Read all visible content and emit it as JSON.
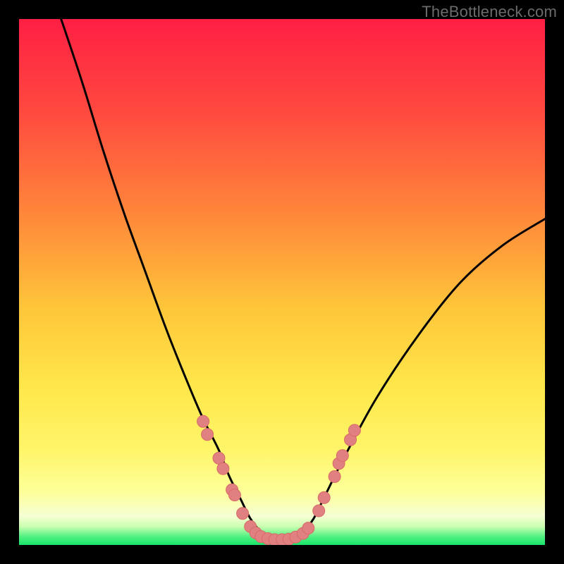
{
  "watermark": "TheBottleneck.com",
  "colors": {
    "frame": "#000000",
    "curve": "#000000",
    "marker_fill": "#e18080",
    "marker_stroke": "#d86a6a",
    "gradient_stops": [
      {
        "offset": 0.0,
        "color": "#ff1f44"
      },
      {
        "offset": 0.18,
        "color": "#ff4a3f"
      },
      {
        "offset": 0.38,
        "color": "#ff8a3a"
      },
      {
        "offset": 0.55,
        "color": "#ffc63a"
      },
      {
        "offset": 0.7,
        "color": "#ffe74a"
      },
      {
        "offset": 0.82,
        "color": "#fff56a"
      },
      {
        "offset": 0.9,
        "color": "#fdff9a"
      },
      {
        "offset": 0.945,
        "color": "#f6ffd4"
      },
      {
        "offset": 0.965,
        "color": "#caffb0"
      },
      {
        "offset": 0.985,
        "color": "#4bf07e"
      },
      {
        "offset": 1.0,
        "color": "#19e46b"
      }
    ]
  },
  "chart_data": {
    "type": "line",
    "title": "",
    "xlabel": "",
    "ylabel": "",
    "xlim": [
      0,
      100
    ],
    "ylim": [
      0,
      100
    ],
    "note": "Axis units not shown in image; values are relative percentages of plot width/height estimated from pixels (0 = left/bottom, 100 = right/top).",
    "series": [
      {
        "name": "bottleneck-curve",
        "x": [
          8,
          12,
          16,
          20,
          24,
          28,
          32,
          35,
          38,
          40,
          42,
          44,
          46,
          48,
          50,
          52,
          54,
          56,
          58,
          62,
          68,
          76,
          84,
          92,
          100
        ],
        "y": [
          100,
          88,
          75,
          63,
          52,
          41,
          31,
          24,
          18,
          13,
          9,
          5,
          2.5,
          1.2,
          1,
          1.2,
          2.5,
          5,
          9,
          17,
          28,
          40,
          50,
          57,
          62
        ]
      }
    ],
    "markers": {
      "name": "highlight-points",
      "comment": "Salmon dots near the valley; coordinates are relative % like the curve.",
      "points": [
        {
          "x": 35.0,
          "y": 23.5
        },
        {
          "x": 35.8,
          "y": 21.0
        },
        {
          "x": 38.0,
          "y": 16.5
        },
        {
          "x": 38.8,
          "y": 14.5
        },
        {
          "x": 40.5,
          "y": 10.5
        },
        {
          "x": 41.0,
          "y": 9.5
        },
        {
          "x": 42.5,
          "y": 6.0
        },
        {
          "x": 44.0,
          "y": 3.5
        },
        {
          "x": 45.0,
          "y": 2.3
        },
        {
          "x": 46.0,
          "y": 1.6
        },
        {
          "x": 47.3,
          "y": 1.2
        },
        {
          "x": 48.6,
          "y": 1.0
        },
        {
          "x": 50.0,
          "y": 1.0
        },
        {
          "x": 51.3,
          "y": 1.1
        },
        {
          "x": 52.6,
          "y": 1.5
        },
        {
          "x": 54.0,
          "y": 2.2
        },
        {
          "x": 55.0,
          "y": 3.2
        },
        {
          "x": 57.0,
          "y": 6.5
        },
        {
          "x": 58.0,
          "y": 9.0
        },
        {
          "x": 60.8,
          "y": 15.5
        },
        {
          "x": 61.5,
          "y": 17.0
        },
        {
          "x": 63.0,
          "y": 20.0
        },
        {
          "x": 63.8,
          "y": 21.8
        },
        {
          "x": 60.0,
          "y": 13.0
        }
      ]
    }
  }
}
